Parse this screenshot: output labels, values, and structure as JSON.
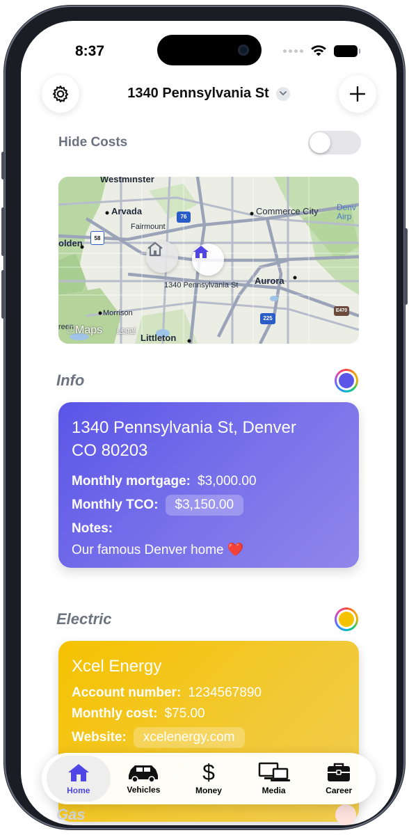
{
  "status": {
    "time": "8:37"
  },
  "header": {
    "title": "1340 Pennsylvania St"
  },
  "hide_costs": {
    "label": "Hide Costs",
    "enabled": false
  },
  "map": {
    "pin_label": "1340 Pennsylvania St",
    "attribution": "Maps",
    "legal": "Legal",
    "places": {
      "westminster": "Westminster",
      "arvada": "Arvada",
      "fairmount": "Fairmount",
      "golden": "olden",
      "commerce_city": "Commerce City",
      "denver_airport": "Denv Airp",
      "aurora": "Aurora",
      "morrison": "Morrison",
      "littleton": "Littleton",
      "greenwood": "reen"
    },
    "shields": {
      "i76": "76",
      "i225": "225",
      "e470": "E470",
      "us58": "58"
    }
  },
  "sections": {
    "info": {
      "title": "Info",
      "ring_color": "#5b55e8",
      "address_line1": "1340 Pennsylvania St, Denver",
      "address_line2": "CO 80203",
      "mortgage_label": "Monthly mortgage:",
      "mortgage_value": "$3,000.00",
      "tco_label": "Monthly TCO:",
      "tco_value": "$3,150.00",
      "notes_label": "Notes:",
      "notes_value": "Our famous Denver home ❤️"
    },
    "electric": {
      "title": "Electric",
      "ring_color": "#f5c200",
      "provider": "Xcel Energy",
      "account_label": "Account number:",
      "account_value": "1234567890",
      "cost_label": "Monthly cost:",
      "cost_value": "$75.00",
      "website_label": "Website:",
      "website_value": "xcelenergy.com"
    },
    "gas": {
      "title": "Gas"
    }
  },
  "tabs": [
    {
      "label": "Home",
      "icon": "house-icon",
      "active": true
    },
    {
      "label": "Vehicles",
      "icon": "car-icon",
      "active": false
    },
    {
      "label": "Money",
      "icon": "dollar-icon",
      "active": false
    },
    {
      "label": "Media",
      "icon": "devices-icon",
      "active": false
    },
    {
      "label": "Career",
      "icon": "briefcase-icon",
      "active": false
    }
  ],
  "colors": {
    "accent": "#4f46e5",
    "info_card": "#5b55e8",
    "electric_card": "#f5c200"
  }
}
